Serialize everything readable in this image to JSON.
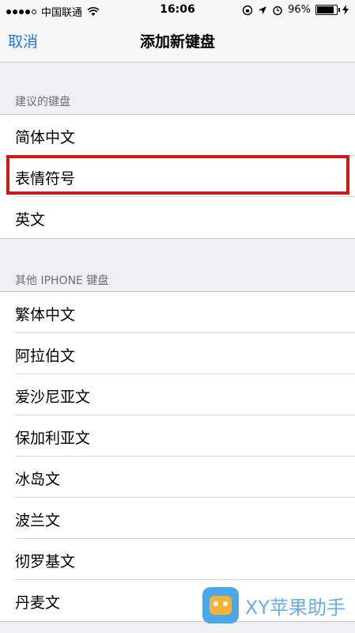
{
  "status_bar": {
    "carrier": "中国联通",
    "time": "16:06",
    "battery": "96%",
    "battery_level": 0.96,
    "icons": [
      "wifi-icon",
      "rotation-lock-icon",
      "location-icon",
      "alarm-icon",
      "charging-icon"
    ]
  },
  "nav": {
    "cancel": "取消",
    "title": "添加新键盘"
  },
  "suggested": {
    "header": "建议的键盘",
    "items": [
      "简体中文",
      "表情符号",
      "英文"
    ]
  },
  "other": {
    "header": "其他 IPHONE 键盘",
    "items": [
      "繁体中文",
      "阿拉伯文",
      "爱沙尼亚文",
      "保加利亚文",
      "冰岛文",
      "波兰文",
      "彻罗基文",
      "丹麦文"
    ]
  },
  "watermark": {
    "text": "XY苹果助手"
  },
  "colors": {
    "accent": "#1a7be0",
    "highlight": "#d01a1a",
    "background": "#efeff4"
  }
}
